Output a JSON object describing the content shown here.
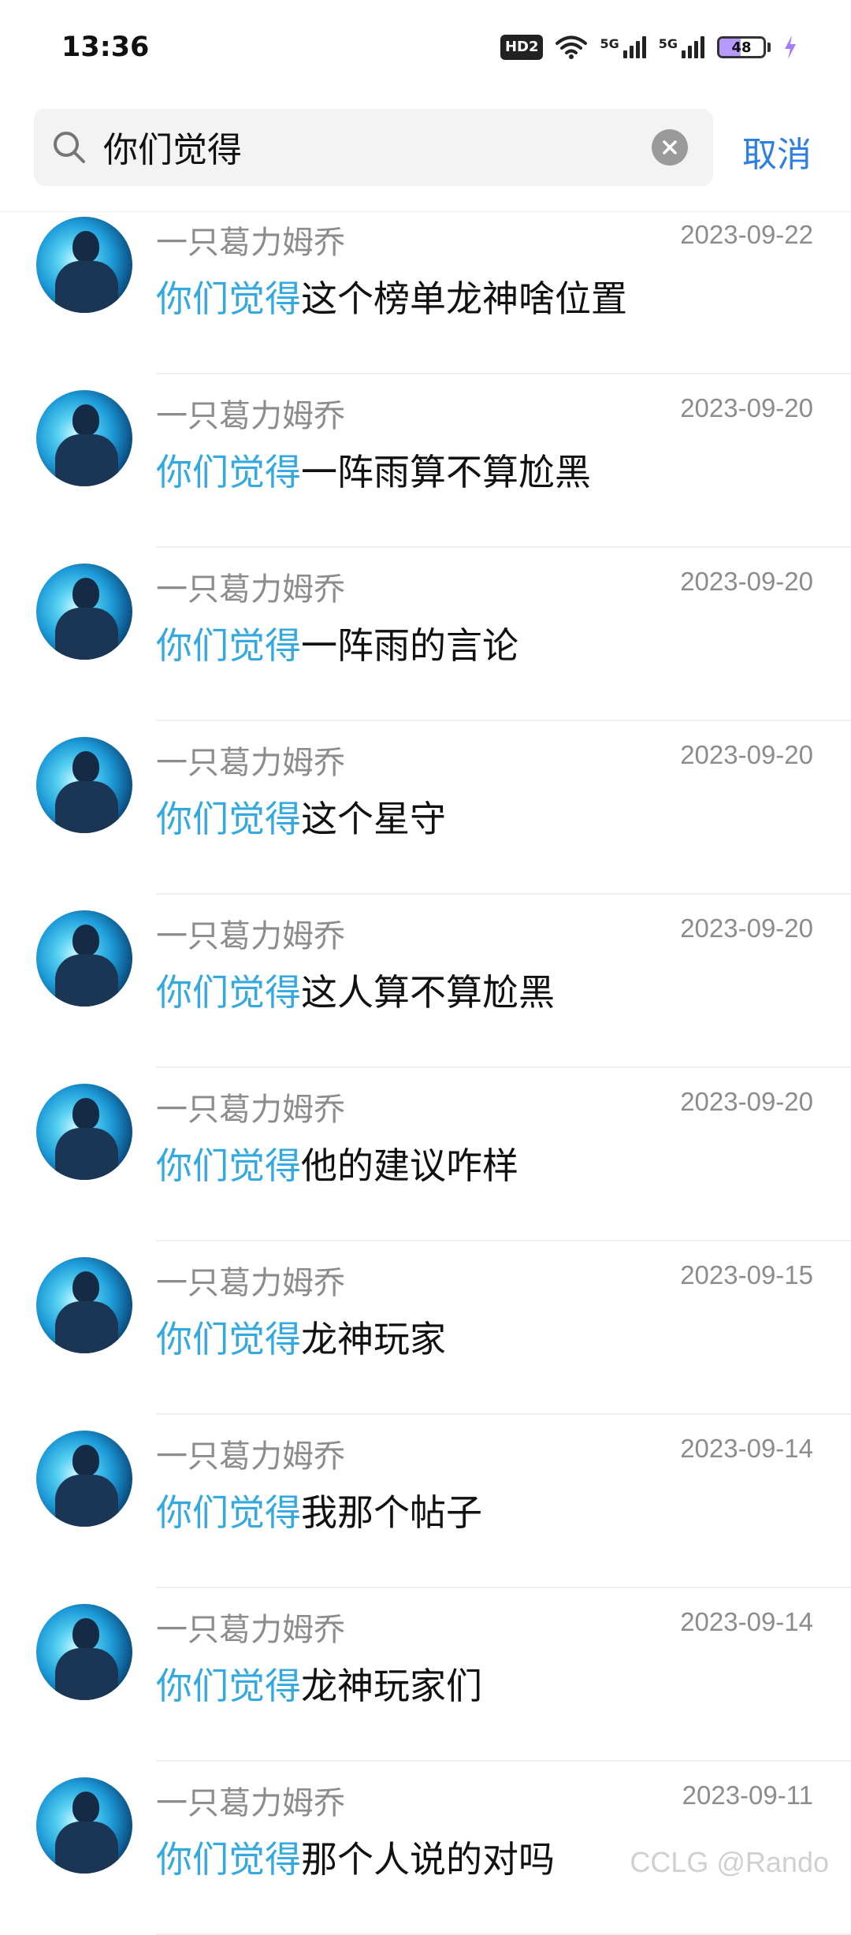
{
  "status_bar": {
    "time": "13:36",
    "hd_label": "HD2",
    "network_1": "5G",
    "network_2": "5G",
    "battery_level": "48",
    "battery_fraction": 0.48
  },
  "search": {
    "query": "你们觉得",
    "cancel_label": "取消"
  },
  "results": [
    {
      "author": "一只葛力姆乔",
      "date": "2023-09-22",
      "highlight": "你们觉得",
      "rest": "这个榜单龙神啥位置"
    },
    {
      "author": "一只葛力姆乔",
      "date": "2023-09-20",
      "highlight": "你们觉得",
      "rest": "一阵雨算不算尬黑"
    },
    {
      "author": "一只葛力姆乔",
      "date": "2023-09-20",
      "highlight": "你们觉得",
      "rest": "一阵雨的言论"
    },
    {
      "author": "一只葛力姆乔",
      "date": "2023-09-20",
      "highlight": "你们觉得",
      "rest": "这个星守"
    },
    {
      "author": "一只葛力姆乔",
      "date": "2023-09-20",
      "highlight": "你们觉得",
      "rest": "这人算不算尬黑"
    },
    {
      "author": "一只葛力姆乔",
      "date": "2023-09-20",
      "highlight": "你们觉得",
      "rest": "他的建议咋样"
    },
    {
      "author": "一只葛力姆乔",
      "date": "2023-09-15",
      "highlight": "你们觉得",
      "rest": "龙神玩家"
    },
    {
      "author": "一只葛力姆乔",
      "date": "2023-09-14",
      "highlight": "你们觉得",
      "rest": "我那个帖子"
    },
    {
      "author": "一只葛力姆乔",
      "date": "2023-09-14",
      "highlight": "你们觉得",
      "rest": "龙神玩家们"
    },
    {
      "author": "一只葛力姆乔",
      "date": "2023-09-11",
      "highlight": "你们觉得",
      "rest": "那个人说的对吗"
    }
  ],
  "watermark": "CCLG @Rando",
  "colors": {
    "accent": "#2f7ee6",
    "highlight": "#33a9e0",
    "muted_text": "#8c8c8c"
  }
}
